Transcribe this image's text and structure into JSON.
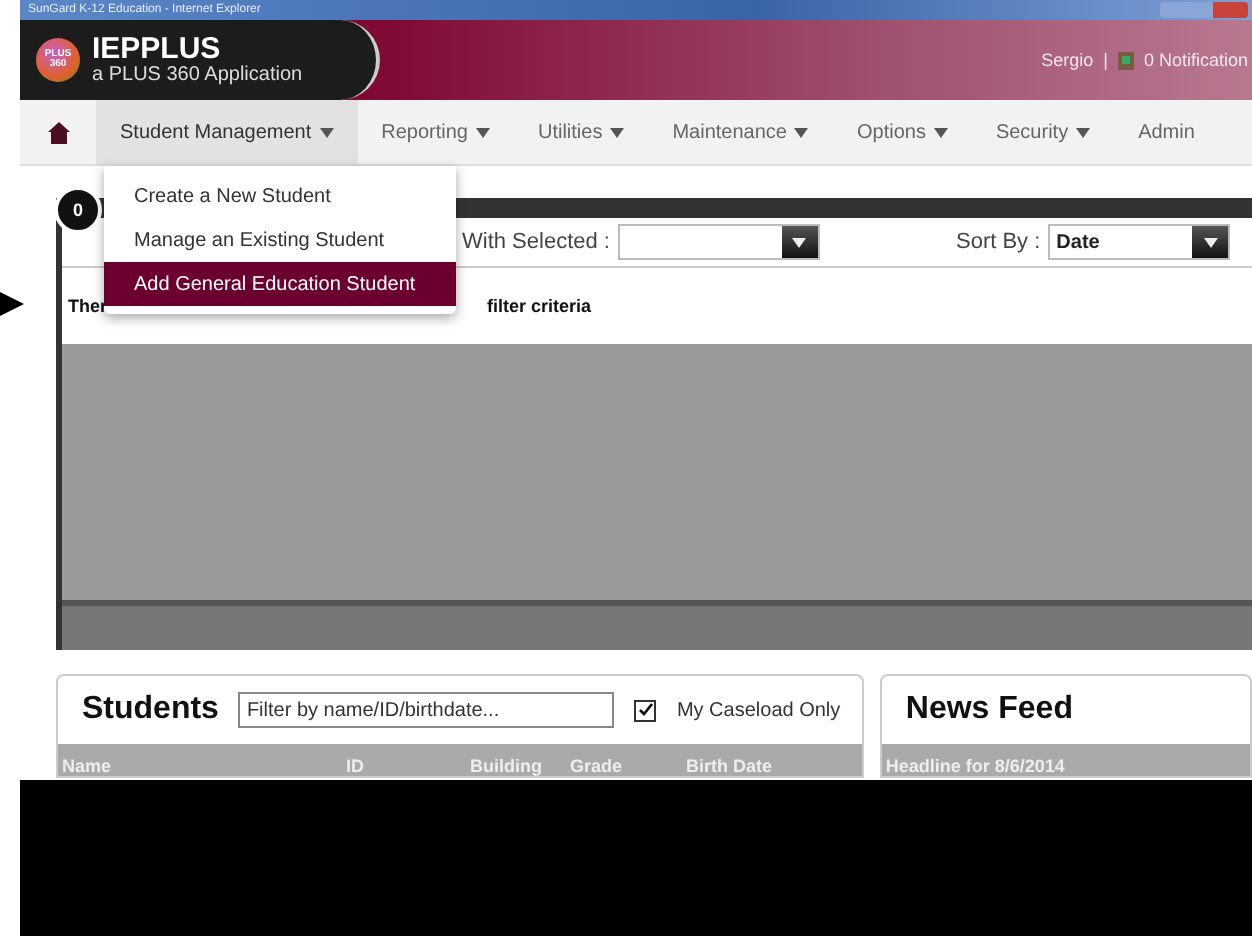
{
  "window": {
    "title": "SunGard K-12 Education - Internet Explorer"
  },
  "header": {
    "app_name": "IEPPLUS",
    "subtitle": "a PLUS 360 Application",
    "logo_text": "PLUS 360",
    "user": "Sergio",
    "separator": "|",
    "notifications": "0 Notification"
  },
  "nav": [
    {
      "label": "Student Management",
      "selected": true,
      "dropdown": true
    },
    {
      "label": "Reporting",
      "selected": false,
      "dropdown": true
    },
    {
      "label": "Utilities",
      "selected": false,
      "dropdown": true
    },
    {
      "label": "Maintenance",
      "selected": false,
      "dropdown": true
    },
    {
      "label": "Options",
      "selected": false,
      "dropdown": true
    },
    {
      "label": "Security",
      "selected": false,
      "dropdown": true
    },
    {
      "label": "Admin",
      "selected": false,
      "dropdown": false
    }
  ],
  "menu": [
    {
      "label": "Create a New Student",
      "selected": false
    },
    {
      "label": "Manage an Existing Student",
      "selected": false
    },
    {
      "label": "Add General Education Student",
      "selected": true
    }
  ],
  "panel": {
    "count": "0",
    "with_selected": "With Selected :",
    "sort_by": "Sort By :",
    "sort_value": "Date",
    "message_start": "Ther",
    "message_end": "filter criteria"
  },
  "students": {
    "title": "Students",
    "filter_placeholder": "Filter by name/ID/birthdate...",
    "caseload_label": "My Caseload Only",
    "caseload_checked": true,
    "columns": [
      "Name",
      "ID",
      "Building",
      "Grade",
      "Birth Date"
    ]
  },
  "news": {
    "title": "News Feed",
    "headline": "Headline for 8/6/2014"
  }
}
